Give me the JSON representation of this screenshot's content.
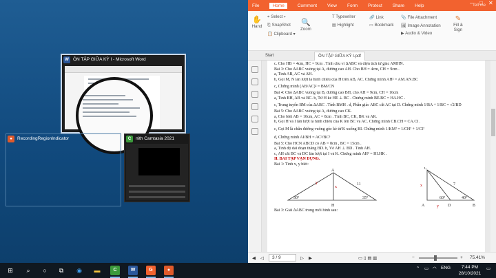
{
  "switcher": {
    "word_title": "ÔN TẬP GIỮA KỲ I - Microsoft Word",
    "recording_title": "RecordingRegionIndicator",
    "camtasia_title": "nith Camtasia 2021"
  },
  "pdf": {
    "menu": [
      "File",
      "Home",
      "Comment",
      "View",
      "Form",
      "Protect",
      "Share",
      "Help"
    ],
    "active_menu": "Home",
    "search_placeholder": "Tell me",
    "ribbon": {
      "hand": "Hand",
      "select": "Select",
      "snapshot": "SnapShot",
      "clipboard": "Clipboard",
      "zoom": "Zoom",
      "typewriter": "Typewriter",
      "highlight": "Highlight",
      "link": "Link",
      "bookmark": "Bookmark",
      "file_attachment": "File Attachment",
      "image_annotation": "Image Annotation",
      "audio_video": "Audio & Video",
      "fill_sign": "Fill & Sign"
    },
    "tabs": [
      "Start",
      "ÔN TẬP GIỮA KỲ I.pdf"
    ],
    "lines": [
      "c. Cho HB = 4cm, HC = 9cm . Tính chu vi  ∆ABC và diện tích tứ giác AMHN.",
      "Bài 3: Cho  ∆ABC vuông tại A, đường cao AH. Cho BH = 4cm, CH = 9cm .",
      "a, Tính AB, AC và AH.",
      "b, Gọi M, N lần lượt là hình chiếu của H trên AB, AC. Chứng minh AH² = AM.AN.BC",
      "c, Chứng minh (AB/AC)² = BM/CN",
      "Bài 4: Cho  ∆ABC vuông tại B, đường cao BH, cho  AH = 9cm, CH = 16cm",
      "a, Tính BH, AB và BC.                          b, Từ H kẻ  HE ⊥ BC . Chứng minh  BE.BC = HA.HC .",
      "c, Trung tuyến BM của ∆ABC . Tính  BMH .          d, Phân giác  ABC  cắt AC tại D. Chứng minh  1/BA + 1/BC = √2/BD",
      "Bài 5: Cho  ∆ABC vuông tại A, đường cao CK.",
      "a, Cho biết AB = 10cm, AC = 8cm . Tính BC, CK, BK và AK.",
      "b, Gọi H và I lần lượt là hình chiếu của K lên BC và AC. Chứng minh  CB.CH = CA.CI .",
      "c, Gọi M là chân đường vuông góc kẻ từ K xuống BI. Chứng minh  1/KM² = 1/CH² + 1/CI²",
      "d, Chứng minh  AI/BH = AC³/BC³",
      "Bài 5: Cho HCN ABCD có  AB = 8cm ,  BC = 15cm .",
      "a, Tính độ dài đoạn thẳng BD.               b, Vẽ  AH ⊥ BD . Tính AH.",
      "c, AH cắt BC và DC lần lượt tại I và K. Chứng minh  AH² = HI.HK .",
      "II. BÀI TẬP VẬN DỤNG.",
      "Bài 1: Tính x, y biết:",
      "Bài 3: Giải  ∆ABC trong mỗi hình sau:"
    ],
    "figure": {
      "a": "A",
      "h": "H",
      "b": "B",
      "c": "C",
      "x": "x",
      "y": "y",
      "n11": "11",
      "a30": "30°",
      "a35": "35°",
      "a40": "40°",
      "a60": "60°",
      "n7": "7",
      "d": "D"
    },
    "status": {
      "page": "3 / 9",
      "zoom": "75.41%"
    }
  },
  "taskbar": {
    "lang": "ENG",
    "time": "7:44 PM",
    "date": "28/10/2021"
  }
}
